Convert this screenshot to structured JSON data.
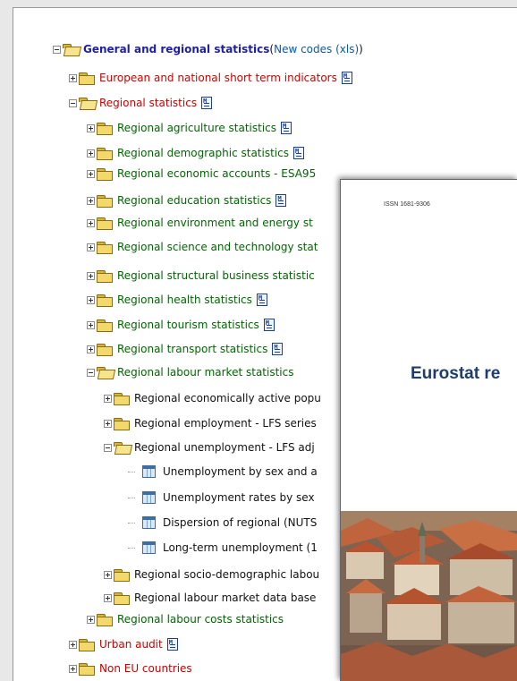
{
  "tree": {
    "root": {
      "label": "General and regional statistics",
      "paren_open": " (",
      "link": "New codes (xls)",
      "paren_close": ")"
    },
    "items": {
      "european": "European and national short term indicators",
      "regional": "Regional statistics",
      "agri": "Regional agriculture statistics",
      "demo": "Regional demographic statistics",
      "econ": "Regional economic accounts - ESA95",
      "edu": "Regional education statistics",
      "env": "Regional environment and energy st",
      "sci": "Regional science and technology stat",
      "struct": "Regional structural business statistic",
      "health": "Regional health statistics",
      "tourism": "Regional tourism statistics",
      "transport": "Regional transport statistics",
      "labour": "Regional labour market statistics",
      "active": "Regional economically active popu",
      "employment": "Regional employment - LFS series",
      "unemployment": "Regional unemployment - LFS adj",
      "t1": "Unemployment by sex and a",
      "t2": "Unemployment rates by sex",
      "t3": "Dispersion of regional (NUTS",
      "t4": "Long-term unemployment (1",
      "socio": "Regional socio-demographic labou",
      "database": "Regional labour market data base",
      "costs": "Regional labour costs statistics",
      "urban": "Urban audit",
      "noneu": "Non EU countries"
    }
  },
  "pamphlet": {
    "issn": "ISSN 1681-9306",
    "title": "Eurostat re"
  },
  "colors": {
    "red": "#cc0000",
    "green": "#006600",
    "blue": "#1d1fa8",
    "link": "#0a59a8"
  }
}
